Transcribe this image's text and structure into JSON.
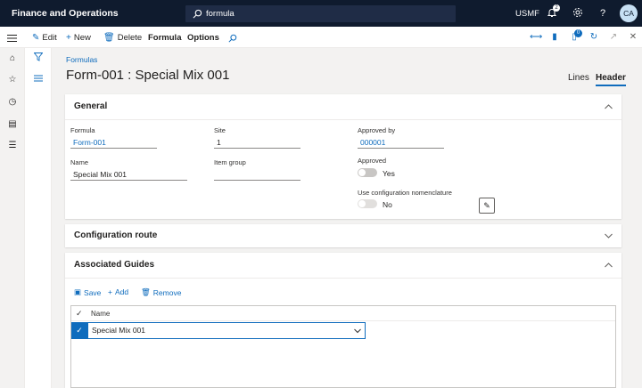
{
  "topbar": {
    "app_title": "Finance and Operations",
    "search_value": "formula",
    "company": "USMF",
    "notification_count": "2",
    "help_glyph": "?",
    "avatar_initials": "CA"
  },
  "actionbar": {
    "edit": "Edit",
    "new": "New",
    "delete": "Delete",
    "formula": "Formula",
    "options": "Options",
    "attach_count": "0"
  },
  "page": {
    "breadcrumb": "Formulas",
    "title": "Form-001 : Special Mix 001",
    "view_lines": "Lines",
    "view_header": "Header"
  },
  "general": {
    "header": "General",
    "formula_label": "Formula",
    "formula_value": "Form-001",
    "name_label": "Name",
    "name_value": "Special Mix 001",
    "site_label": "Site",
    "site_value": "1",
    "item_group_label": "Item group",
    "item_group_value": "",
    "approved_by_label": "Approved by",
    "approved_by_value": "000001",
    "approved_label": "Approved",
    "approved_value": "Yes",
    "use_config_label": "Use configuration nomenclature",
    "use_config_value": "No"
  },
  "config_route": {
    "header": "Configuration route"
  },
  "guides": {
    "header": "Associated Guides",
    "save": "Save",
    "add": "Add",
    "remove": "Remove",
    "column_name": "Name",
    "rows": [
      {
        "name": "Special Mix 001"
      }
    ]
  },
  "colors": {
    "topbar": "#0f1b2e",
    "accent": "#0f6cbd",
    "background": "#f3f2f1"
  },
  "icons": [
    "waffle-icon",
    "search-icon",
    "bell-icon",
    "gear-icon",
    "help-icon",
    "hamburger-icon",
    "home-icon",
    "star-icon",
    "clock-icon",
    "workspace-icon",
    "list-icon",
    "filter-icon",
    "edit-icon",
    "plus-icon",
    "trash-icon",
    "chevron-up-icon",
    "chevron-down-icon",
    "checkmark-icon"
  ]
}
